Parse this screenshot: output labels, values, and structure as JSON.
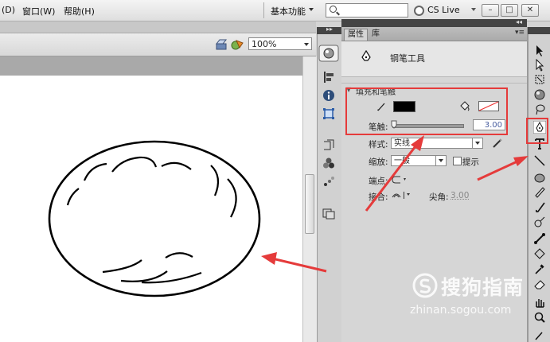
{
  "menubar": {
    "items": [
      "(D)",
      "窗口(W)",
      "帮助(H)"
    ],
    "workspace": "基本功能",
    "cs_live": "CS Live"
  },
  "stage": {
    "zoom": "100%"
  },
  "panel": {
    "tabs": [
      "属性",
      "库"
    ],
    "tool_name": "钢笔工具",
    "section_title": "填充和笔触",
    "stroke_label": "笔触:",
    "stroke_value": "3.00",
    "style_label": "样式:",
    "style_value": "实线",
    "scale_label": "缩放:",
    "scale_value": "一般",
    "hint_label": "提示",
    "cap_label": "端点:",
    "join_label": "接合:",
    "miter_label": "尖角:",
    "miter_value": "3.00"
  },
  "watermark": {
    "brand": "搜狗指南",
    "url": "zhinan.sogou.com"
  },
  "colors": {
    "highlight": "#e53b3b",
    "stroke_color": "#000000"
  }
}
